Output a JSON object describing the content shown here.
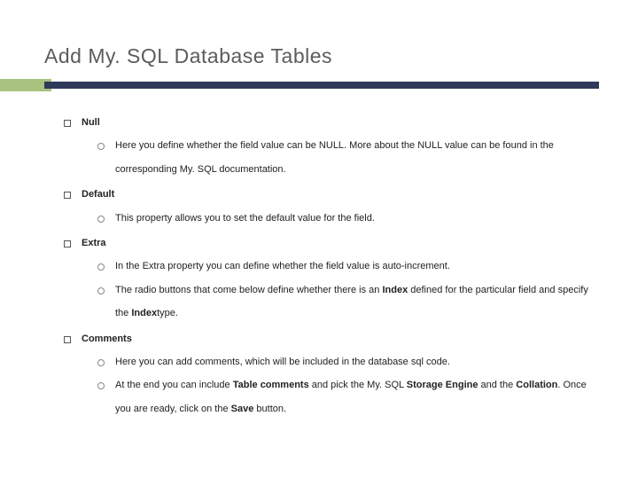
{
  "title": "Add My. SQL Database Tables",
  "sections": [
    {
      "label": "Null",
      "items": [
        {
          "runs": [
            {
              "t": "Here you define whether the field value can be NULL. More about the NULL value can be found in the corresponding My. SQL documentation."
            }
          ]
        }
      ]
    },
    {
      "label": "Default",
      "items": [
        {
          "runs": [
            {
              "t": "This property allows you to set the default value for the field."
            }
          ]
        }
      ]
    },
    {
      "label": "Extra",
      "items": [
        {
          "runs": [
            {
              "t": "In the Extra property you can define whether the field value is auto-increment."
            }
          ]
        },
        {
          "runs": [
            {
              "t": "The radio buttons that come below define whether there is an "
            },
            {
              "t": "Index",
              "b": true
            },
            {
              "t": " defined for the particular field and specify the "
            },
            {
              "t": "Index",
              "b": true
            },
            {
              "t": "type."
            }
          ]
        }
      ]
    },
    {
      "label": "Comments",
      "items": [
        {
          "runs": [
            {
              "t": "Here you can add comments, which will be included in the database sql code."
            }
          ]
        },
        {
          "runs": [
            {
              "t": "At the end you can include "
            },
            {
              "t": "Table comments",
              "b": true
            },
            {
              "t": " and pick the My. SQL "
            },
            {
              "t": "Storage Engine",
              "b": true
            },
            {
              "t": " and the "
            },
            {
              "t": "Collation",
              "b": true
            },
            {
              "t": ". Once you are ready, click on the "
            },
            {
              "t": "Save",
              "b": true
            },
            {
              "t": " button."
            }
          ]
        }
      ]
    }
  ]
}
